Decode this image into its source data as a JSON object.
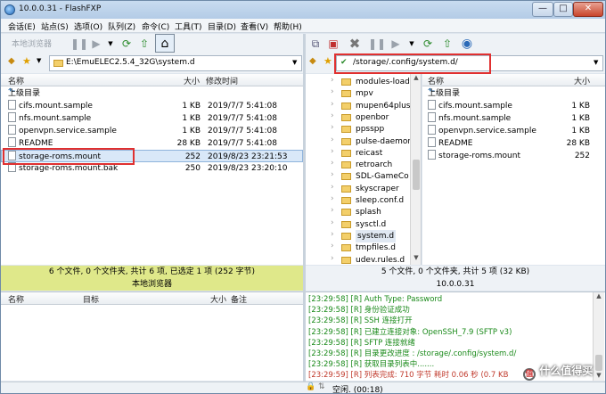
{
  "window": {
    "title": "10.0.0.31 - FlashFXP",
    "controls": {
      "min": "—",
      "max": "□",
      "close": "✕"
    }
  },
  "menu": [
    "会话(E)",
    "站点(S)",
    "选项(O)",
    "队列(Z)",
    "命令(C)",
    "工具(T)",
    "目录(D)",
    "查看(V)",
    "帮助(H)"
  ],
  "left": {
    "toolbar": {
      "browser_label": "本地浏览器"
    },
    "path": "E:\\EmuELEC2.5.4_32G\\system.d",
    "columns": {
      "name": "名称",
      "size": "大小",
      "modified": "修改时间"
    },
    "up_label": "上级目录",
    "files": [
      {
        "name": "cifs.mount.sample",
        "size": "1 KB",
        "date": "2019/7/7 5:41:08"
      },
      {
        "name": "nfs.mount.sample",
        "size": "1 KB",
        "date": "2019/7/7 5:41:08"
      },
      {
        "name": "openvpn.service.sample",
        "size": "1 KB",
        "date": "2019/7/7 5:41:08"
      },
      {
        "name": "README",
        "size": "28 KB",
        "date": "2019/7/7 5:41:08"
      },
      {
        "name": "storage-roms.mount",
        "size": "252",
        "date": "2019/8/23 23:21:53"
      },
      {
        "name": "storage-roms.mount.bak",
        "size": "250",
        "date": "2019/8/23 23:20:10"
      }
    ],
    "status": "6 个文件, 0 个文件夹, 共计 6 项, 已选定 1 项 (252 字节)",
    "status2": "本地浏览器"
  },
  "right": {
    "path": "/storage/.config/system.d/",
    "tree": [
      "modules-load",
      "mpv",
      "mupen64plus",
      "openbor",
      "ppsspp",
      "pulse-daemon",
      "reicast",
      "retroarch",
      "SDL-GameCo",
      "skyscraper",
      "sleep.conf.d",
      "splash",
      "sysctl.d",
      "system.d",
      "tmpfiles.d",
      "udev.rules.d"
    ],
    "columns": {
      "name": "名称",
      "size": "大小"
    },
    "up_label": "上级目录",
    "files": [
      {
        "name": "cifs.mount.sample",
        "size": "1 KB"
      },
      {
        "name": "nfs.mount.sample",
        "size": "1 KB"
      },
      {
        "name": "openvpn.service.sample",
        "size": "1 KB"
      },
      {
        "name": "README",
        "size": "28 KB"
      },
      {
        "name": "storage-roms.mount",
        "size": "252"
      }
    ],
    "status": "5 个文件, 0 个文件夹, 共计 5 项 (32 KB)",
    "status2": "10.0.0.31"
  },
  "queue": {
    "columns": {
      "name": "名称",
      "target": "目标",
      "size": "大小",
      "note": "备注"
    }
  },
  "log": [
    "[23:29:58] [R] Auth Type: Password",
    "[23:29:58] [R] 身份验证成功",
    "[23:29:58] [R] SSH 连接打开",
    "[23:29:58] [R] 已建立连接对象: OpenSSH_7.9 (SFTP v3)",
    "[23:29:58] [R] SFTP 连接就绪",
    "[23:29:58] [R] 目录更改进度 : /storage/.config/system.d/",
    "[23:29:58] [R] 获取目录列表中.......",
    "[23:29:59] [R] 列表完成: 710 字节 耗时 0.06 秒 (0.7 KB"
  ],
  "bottom_status": "空闲. (00:18)",
  "watermark": "什么值得买"
}
